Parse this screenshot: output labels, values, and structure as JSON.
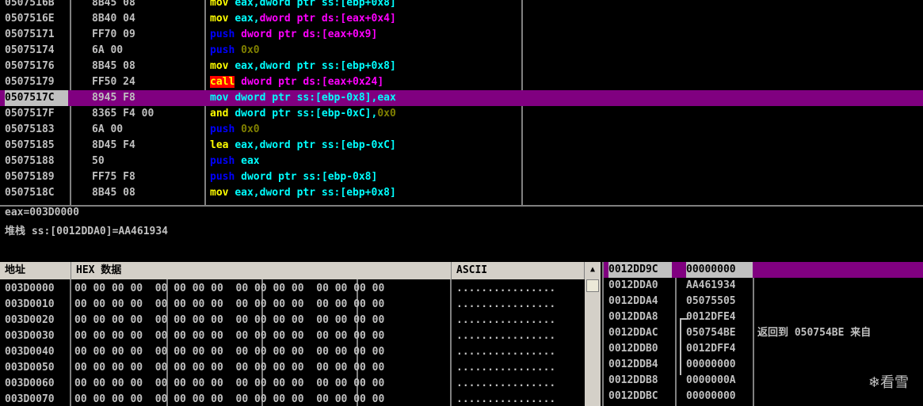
{
  "disasm": {
    "rows": [
      {
        "addr": "0507516B",
        "hex": "8B45 08",
        "ins": [
          {
            "t": "mov ",
            "c": "t-mov"
          },
          {
            "t": "eax,",
            "c": "t-op"
          },
          {
            "t": "dword ptr ss:[ebp+0x8]",
            "c": "t-op"
          }
        ]
      },
      {
        "addr": "0507516E",
        "hex": "8B40 04",
        "ins": [
          {
            "t": "mov ",
            "c": "t-mov"
          },
          {
            "t": "eax,",
            "c": "t-op"
          },
          {
            "t": "dword ptr ds:[eax+0x4]",
            "c": "t-mem"
          }
        ]
      },
      {
        "addr": "05075171",
        "hex": "FF70 09",
        "ins": [
          {
            "t": "push ",
            "c": "t-push"
          },
          {
            "t": "dword ptr ds:[eax+0x9]",
            "c": "t-mem"
          }
        ]
      },
      {
        "addr": "05075174",
        "hex": "6A 00",
        "ins": [
          {
            "t": "push ",
            "c": "t-push"
          },
          {
            "t": "0x0",
            "c": "t-imm"
          }
        ]
      },
      {
        "addr": "05075176",
        "hex": "8B45 08",
        "ins": [
          {
            "t": "mov ",
            "c": "t-mov"
          },
          {
            "t": "eax,",
            "c": "t-op"
          },
          {
            "t": "dword ptr ss:[ebp+0x8]",
            "c": "t-op"
          }
        ]
      },
      {
        "addr": "05075179",
        "hex": "FF50 24",
        "ins": [
          {
            "t": "call",
            "c": "t-call"
          },
          {
            "t": " ",
            "c": ""
          },
          {
            "t": "dword ptr ds:[eax+0x24]",
            "c": "t-mem"
          }
        ]
      },
      {
        "addr": "0507517C",
        "hex": "8945 F8",
        "sel": true,
        "ins": [
          {
            "t": "mov ",
            "c": "t-mov"
          },
          {
            "t": "dword ptr ss:[ebp-0x8],eax",
            "c": "t-op"
          }
        ]
      },
      {
        "addr": "0507517F",
        "hex": "8365 F4 00",
        "ins": [
          {
            "t": "and ",
            "c": "t-and"
          },
          {
            "t": "dword ptr ss:[ebp-0xC],",
            "c": "t-op"
          },
          {
            "t": "0x0",
            "c": "t-imm"
          }
        ]
      },
      {
        "addr": "05075183",
        "hex": "6A 00",
        "ins": [
          {
            "t": "push ",
            "c": "t-push"
          },
          {
            "t": "0x0",
            "c": "t-imm"
          }
        ]
      },
      {
        "addr": "05075185",
        "hex": "8D45 F4",
        "ins": [
          {
            "t": "lea ",
            "c": "t-lea"
          },
          {
            "t": "eax,",
            "c": "t-op"
          },
          {
            "t": "dword ptr ss:[ebp-0xC]",
            "c": "t-op"
          }
        ]
      },
      {
        "addr": "05075188",
        "hex": "50",
        "ins": [
          {
            "t": "push ",
            "c": "t-push"
          },
          {
            "t": "eax",
            "c": "t-op"
          }
        ]
      },
      {
        "addr": "05075189",
        "hex": "FF75 F8",
        "ins": [
          {
            "t": "push ",
            "c": "t-push"
          },
          {
            "t": "dword ptr ss:[ebp-0x8]",
            "c": "t-op"
          }
        ]
      },
      {
        "addr": "0507518C",
        "hex": "8B45 08",
        "ins": [
          {
            "t": "mov ",
            "c": "t-mov"
          },
          {
            "t": "eax,",
            "c": "t-op"
          },
          {
            "t": "dword ptr ss:[ebp+0x8]",
            "c": "t-op"
          }
        ]
      }
    ]
  },
  "info": {
    "line1": "eax=003D0000",
    "line2": "堆栈 ss:[0012DDA0]=AA461934"
  },
  "dump": {
    "header_addr": "地址",
    "header_hex": "HEX 数据",
    "header_ascii": "ASCII",
    "rows": [
      {
        "addr": "003D0000",
        "bytes": "00 00 00 00  00 00 00 00  00 00 00 00  00 00 00 00",
        "ascii": "................"
      },
      {
        "addr": "003D0010",
        "bytes": "00 00 00 00  00 00 00 00  00 00 00 00  00 00 00 00",
        "ascii": "................"
      },
      {
        "addr": "003D0020",
        "bytes": "00 00 00 00  00 00 00 00  00 00 00 00  00 00 00 00",
        "ascii": "................"
      },
      {
        "addr": "003D0030",
        "bytes": "00 00 00 00  00 00 00 00  00 00 00 00  00 00 00 00",
        "ascii": "................"
      },
      {
        "addr": "003D0040",
        "bytes": "00 00 00 00  00 00 00 00  00 00 00 00  00 00 00 00",
        "ascii": "................"
      },
      {
        "addr": "003D0050",
        "bytes": "00 00 00 00  00 00 00 00  00 00 00 00  00 00 00 00",
        "ascii": "................"
      },
      {
        "addr": "003D0060",
        "bytes": "00 00 00 00  00 00 00 00  00 00 00 00  00 00 00 00",
        "ascii": "................"
      },
      {
        "addr": "003D0070",
        "bytes": "00 00 00 00  00 00 00 00  00 00 00 00  00 00 00 00",
        "ascii": "................"
      }
    ]
  },
  "stack": {
    "rows": [
      {
        "addr": "0012DD9C",
        "val": "00000000",
        "comment": "",
        "sel": true
      },
      {
        "addr": "0012DDA0",
        "val": "AA461934",
        "comment": ""
      },
      {
        "addr": "0012DDA4",
        "val": "05075505",
        "comment": ""
      },
      {
        "addr": "0012DDA8",
        "val": "0012DFE4",
        "comment": ""
      },
      {
        "addr": "0012DDAC",
        "val": "050754BE",
        "comment": "返回到 050754BE 来自"
      },
      {
        "addr": "0012DDB0",
        "val": "0012DFF4",
        "comment": ""
      },
      {
        "addr": "0012DDB4",
        "val": "00000000",
        "comment": ""
      },
      {
        "addr": "0012DDB8",
        "val": "0000000A",
        "comment": ""
      },
      {
        "addr": "0012DDBC",
        "val": "00000000",
        "comment": ""
      }
    ]
  },
  "watermark": {
    "icon": "snowflake-icon",
    "text": "看雪"
  },
  "colors": {
    "selection": "#800080",
    "mnemonic": "#ffff00",
    "push": "#0000ff",
    "memory": "#ff00ff",
    "operand": "#00ffff",
    "immediate": "#808000",
    "call_bg": "#ff0000"
  }
}
